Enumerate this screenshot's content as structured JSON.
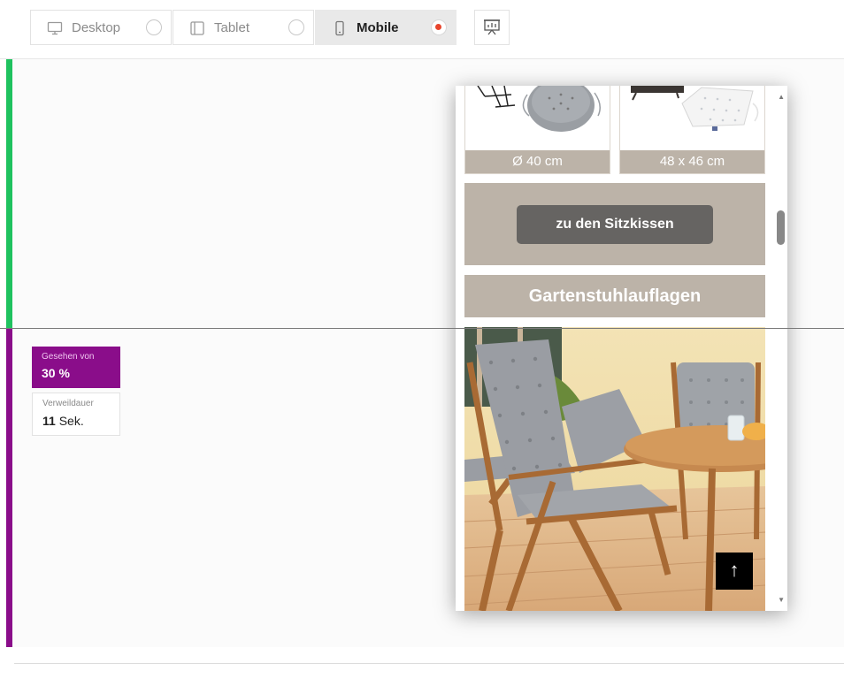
{
  "device_tabs": [
    {
      "label": "Desktop",
      "icon": "desktop-icon",
      "selected": false
    },
    {
      "label": "Tablet",
      "icon": "tablet-icon",
      "selected": false
    },
    {
      "label": "Mobile",
      "icon": "mobile-icon",
      "selected": true
    }
  ],
  "toolbar": {
    "present_icon": "presentation-icon"
  },
  "zones": [
    {
      "color": "#1fc25f"
    },
    {
      "color": "#8a0d8a"
    }
  ],
  "stats": {
    "seen_label": "Gesehen von",
    "seen_value": "30 %",
    "time_label": "Verweildauer",
    "time_number": "11",
    "time_unit": "Sek."
  },
  "preview": {
    "products": [
      {
        "caption": "Ø 40 cm",
        "image": "round-seat-cushion"
      },
      {
        "caption": "48 x 46 cm",
        "image": "square-seat-cushion"
      }
    ],
    "cta_label": "zu den Sitzkissen",
    "section_title": "Gartenstuhlauflagen",
    "photo": "garden-chairs-with-cushions-photo",
    "to_top_glyph": "↑"
  },
  "colors": {
    "accent_purple": "#8a0d8a",
    "accent_green": "#1fc25f",
    "brand_beige": "#bcb3a8",
    "radio_selected": "#e8452c"
  }
}
